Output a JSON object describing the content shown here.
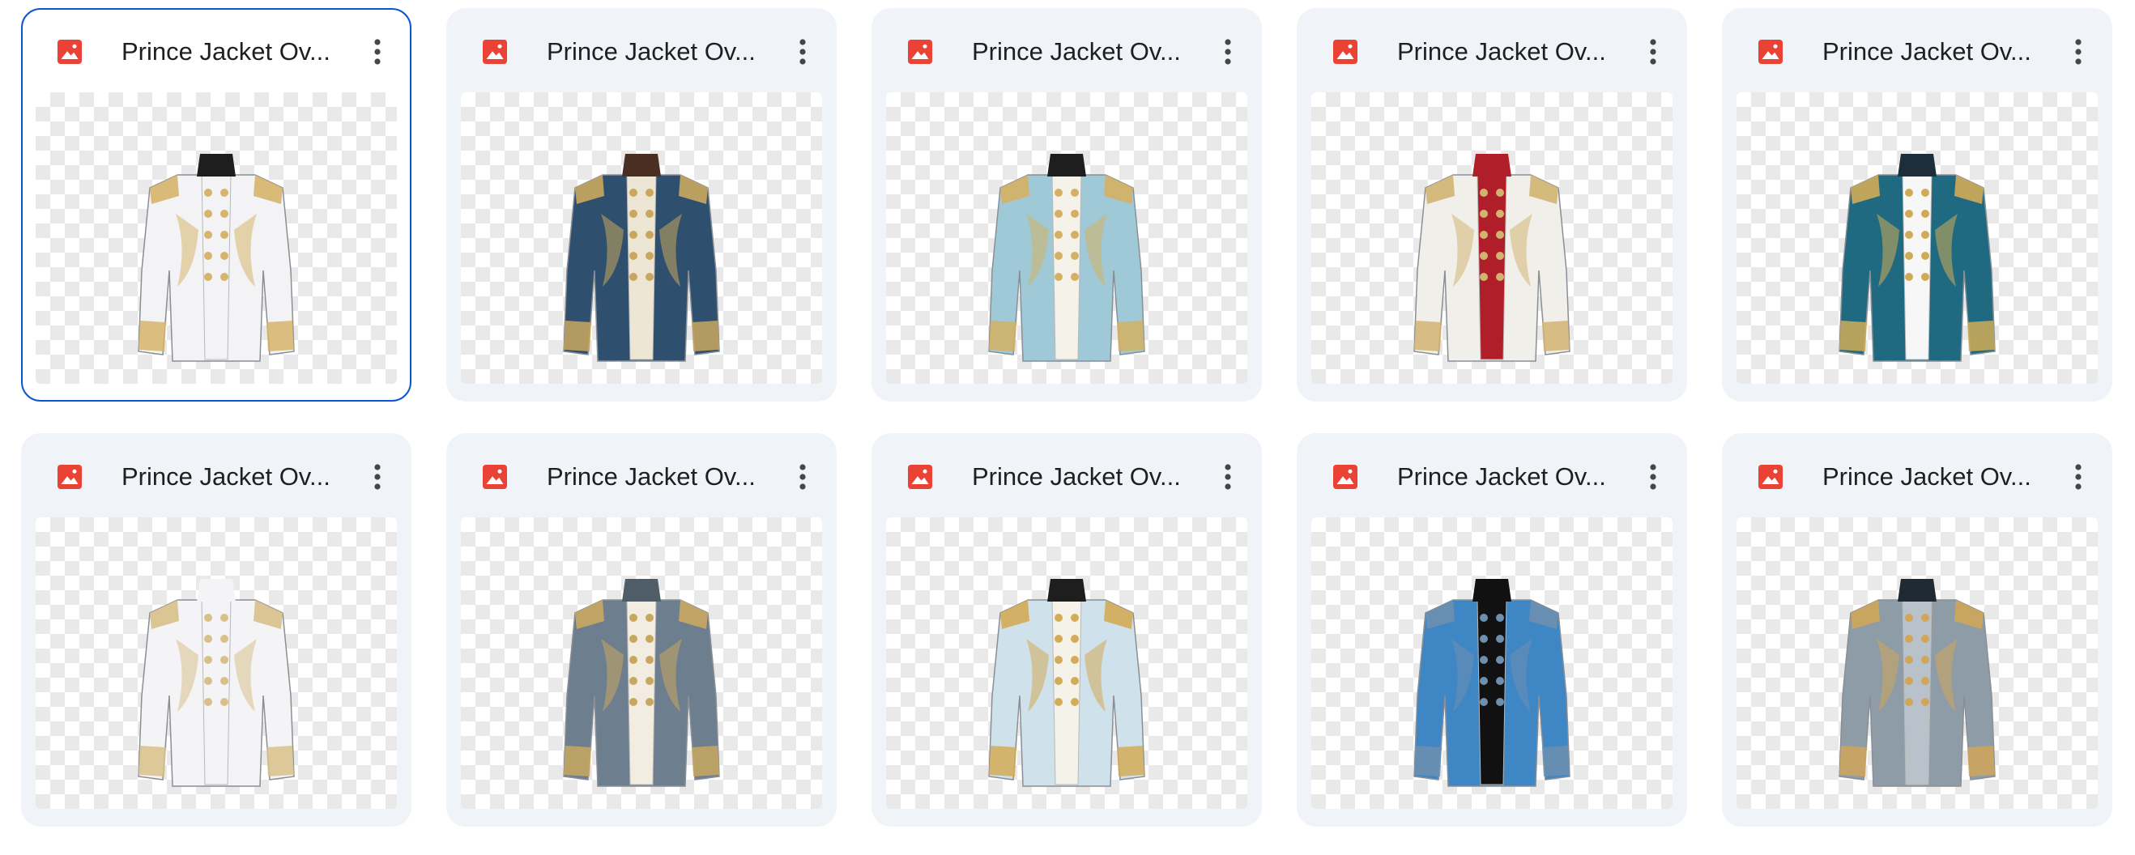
{
  "files": [
    {
      "title": "Prince Jacket Ov...",
      "selected": true,
      "body_color": "#f3f3f6",
      "trim_color": "#d6b46a",
      "collar_color": "#1e1e1e",
      "lapel_color": "#f3f3f6"
    },
    {
      "title": "Prince Jacket Ov...",
      "selected": false,
      "body_color": "#2f4f6e",
      "trim_color": "#c9a75e",
      "collar_color": "#4a2e22",
      "lapel_color": "#eee6d4"
    },
    {
      "title": "Prince Jacket Ov...",
      "selected": false,
      "body_color": "#9fc9d6",
      "trim_color": "#d4b064",
      "collar_color": "#1e1e1e",
      "lapel_color": "#f5f2ea"
    },
    {
      "title": "Prince Jacket Ov...",
      "selected": false,
      "body_color": "#f1efea",
      "trim_color": "#d2b471",
      "collar_color": "#b01e2a",
      "lapel_color": "#b01e2a"
    },
    {
      "title": "Prince Jacket Ov...",
      "selected": false,
      "body_color": "#1f6a80",
      "trim_color": "#d0ab57",
      "collar_color": "#1d2d3a",
      "lapel_color": "#f7f7f7"
    },
    {
      "title": "Prince Jacket Ov...",
      "selected": false,
      "body_color": "#f4f4f6",
      "trim_color": "#d8c08a",
      "collar_color": "#f4f4f6",
      "lapel_color": "#f4f4f6"
    },
    {
      "title": "Prince Jacket Ov...",
      "selected": false,
      "body_color": "#6d7f8e",
      "trim_color": "#c8a860",
      "collar_color": "#4f5d68",
      "lapel_color": "#f2ede0"
    },
    {
      "title": "Prince Jacket Ov...",
      "selected": false,
      "body_color": "#cfe1ea",
      "trim_color": "#d2ac58",
      "collar_color": "#1e1e1e",
      "lapel_color": "#f5f2ea"
    },
    {
      "title": "Prince Jacket Ov...",
      "selected": false,
      "body_color": "#3f86c4",
      "trim_color": "#6d8fb0",
      "collar_color": "#111111",
      "lapel_color": "#111111"
    },
    {
      "title": "Prince Jacket Ov...",
      "selected": false,
      "body_color": "#8e9ca8",
      "trim_color": "#cfa65a",
      "collar_color": "#202a33",
      "lapel_color": "#b9c2cb"
    }
  ],
  "icons": {
    "file_type": "image-file-icon",
    "menu": "more-vert-icon"
  },
  "colors": {
    "file_icon": "#ea4335",
    "selection_border": "#0b57d0",
    "card_bg": "#f0f4f9",
    "title_text": "#1f1f1f",
    "menu_icon": "#444746"
  }
}
